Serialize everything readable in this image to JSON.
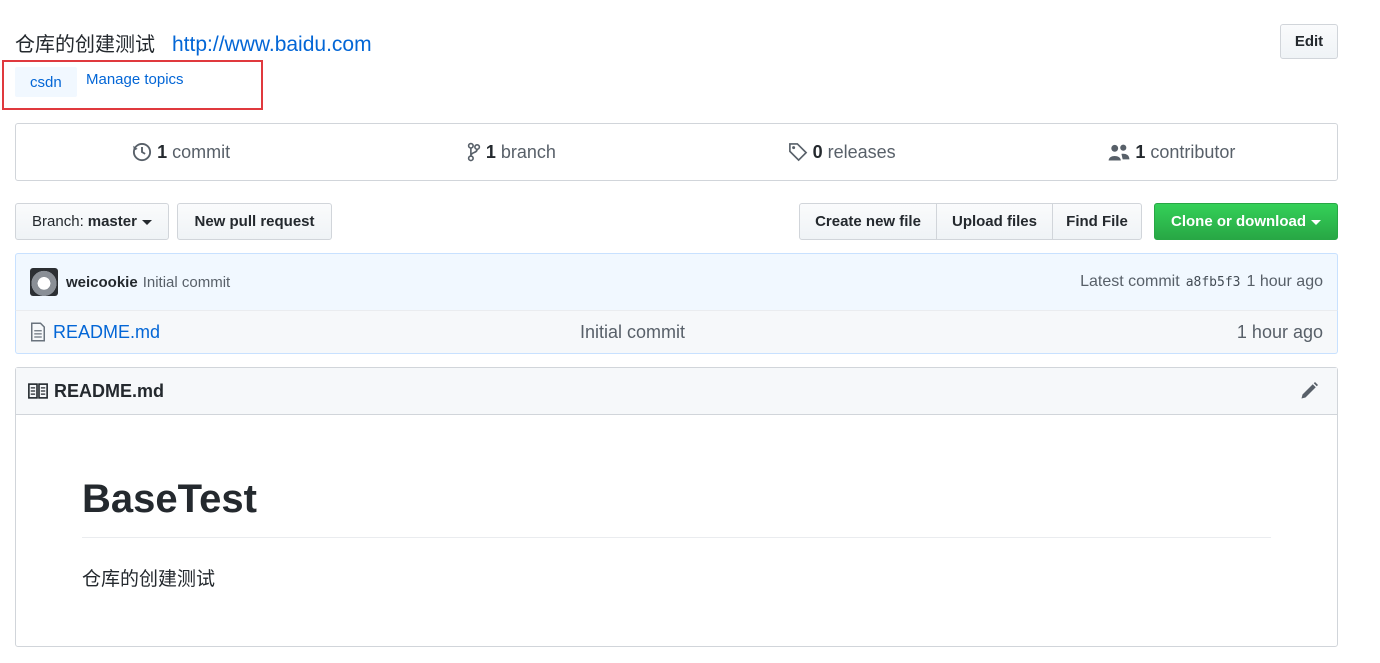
{
  "repo": {
    "description": "仓库的创建测试",
    "website": "http://www.baidu.com",
    "edit_label": "Edit"
  },
  "topics": {
    "tags": [
      "csdn"
    ],
    "manage_label": "Manage topics"
  },
  "summary": {
    "commits": {
      "count": "1",
      "label": "commit"
    },
    "branches": {
      "count": "1",
      "label": "branch"
    },
    "releases": {
      "count": "0",
      "label": "releases"
    },
    "contributors": {
      "count": "1",
      "label": "contributor"
    }
  },
  "toolbar": {
    "branch_prefix": "Branch:",
    "branch_name": "master",
    "new_pull_request": "New pull request",
    "create_new_file": "Create new file",
    "upload_files": "Upload files",
    "find_file": "Find File",
    "clone_or_download": "Clone or download"
  },
  "latest_commit": {
    "author": "weicookie",
    "message": "Initial commit",
    "label": "Latest commit",
    "sha": "a8fb5f3",
    "age": "1 hour ago"
  },
  "files": [
    {
      "name": "README.md",
      "message": "Initial commit",
      "age": "1 hour ago"
    }
  ],
  "readme": {
    "filename": "README.md",
    "heading": "BaseTest",
    "paragraph": "仓库的创建测试"
  },
  "colors": {
    "link": "#0366d6",
    "clone_green": "#28a745",
    "highlight_red": "#e0393e"
  },
  "icons": [
    "history-icon",
    "git-branch-icon",
    "tag-icon",
    "people-icon",
    "file-icon",
    "book-icon",
    "pencil-icon"
  ]
}
